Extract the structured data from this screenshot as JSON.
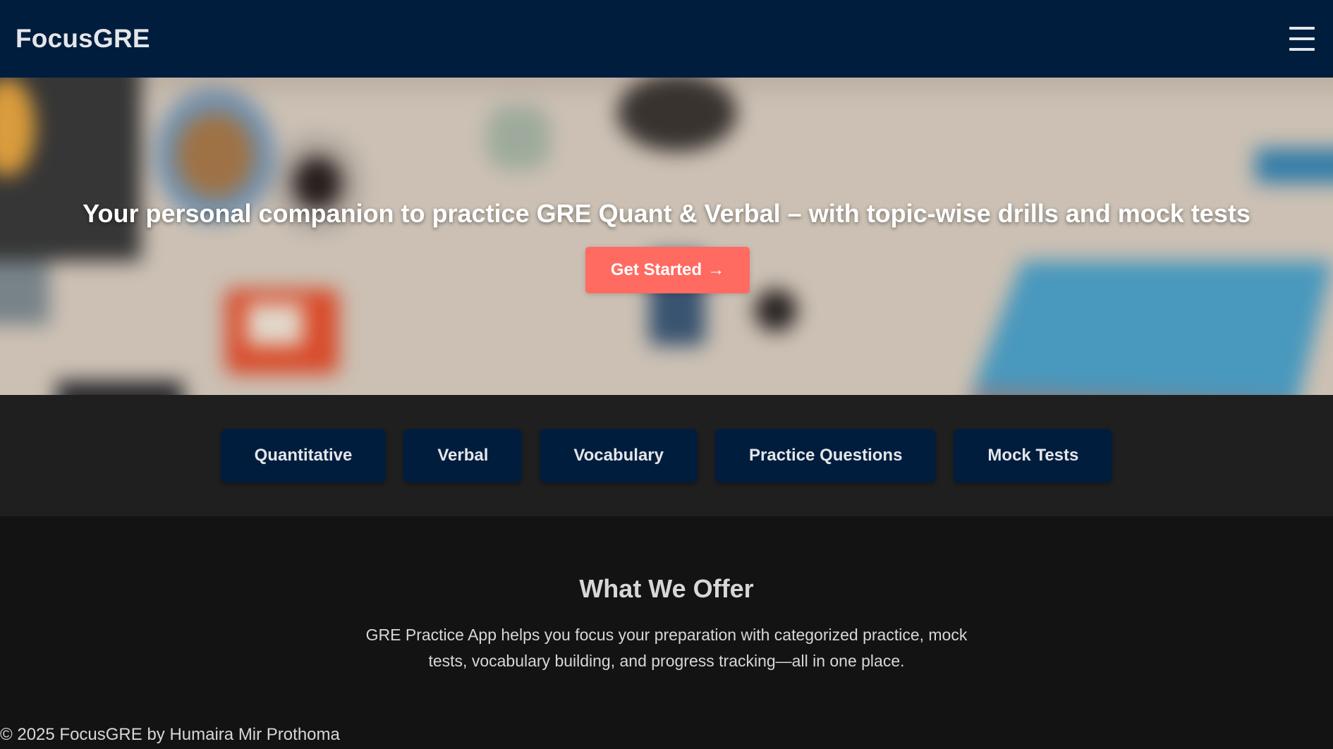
{
  "nav": {
    "brand": "FocusGRE",
    "menu_icon": "hamburger-menu-icon"
  },
  "hero": {
    "headline": "Your personal companion to practice GRE Quant & Verbal – with topic-wise drills and mock tests",
    "cta_label": "Get Started",
    "cta_arrow": "→"
  },
  "categories": [
    {
      "label": "Quantitative"
    },
    {
      "label": "Verbal"
    },
    {
      "label": "Vocabulary"
    },
    {
      "label": "Practice Questions"
    },
    {
      "label": "Mock Tests"
    }
  ],
  "offer": {
    "title": "What We Offer",
    "text": "GRE Practice App helps you focus your preparation with categorized practice, mock tests, vocabulary building, and progress tracking—all in one place."
  },
  "footer": {
    "text": "© 2025 FocusGRE by Humaira Mir Prothoma"
  },
  "colors": {
    "navbar": "#001d3d",
    "cta": "#ff6b61",
    "category_button": "#001d3d",
    "categories_bg": "#1f1f1f",
    "page_bg": "#131313"
  }
}
